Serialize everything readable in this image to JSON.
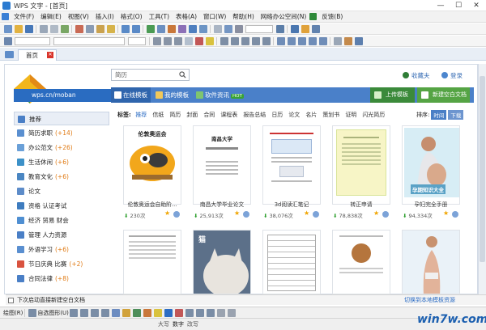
{
  "window": {
    "title": "WPS 文字 - [首页]",
    "minimize": "—",
    "maximize": "☐",
    "close": "✕"
  },
  "menu": [
    "文件(F)",
    "编辑(E)",
    "视图(V)",
    "插入(I)",
    "格式(O)",
    "工具(T)",
    "表格(A)",
    "窗口(W)",
    "帮助(H)",
    "网络办公空间(N)",
    "反馈(B)"
  ],
  "menu_extra": {
    "feedback_icon": "feedback-icon"
  },
  "tabs": [
    {
      "label": "首页",
      "close": "✕"
    }
  ],
  "site": {
    "logo_text": "wps.cn/moban",
    "search_placeholder": "简历",
    "favorite": "收藏夫",
    "login": "登录"
  },
  "nav": {
    "online": "在线模板",
    "mine": "我的模板",
    "software": "软件资讯",
    "hot": "HOT",
    "upload": "上传模板",
    "new_blank": "新建空白文档"
  },
  "sidebar": [
    {
      "label": "推荐",
      "count": "",
      "color": "#4a7fc6"
    },
    {
      "label": "简历求职",
      "count": "(+14)",
      "color": "#5a8fd0"
    },
    {
      "label": "办公范文",
      "count": "(+26)",
      "color": "#6aa0d8"
    },
    {
      "label": "生活休闲",
      "count": "(+6)",
      "color": "#3c91c8"
    },
    {
      "label": "教育文化",
      "count": "(+6)",
      "color": "#4a86c2"
    },
    {
      "label": "论文",
      "count": "",
      "color": "#5d8cc9"
    },
    {
      "label": "资格 认证考试",
      "count": "",
      "color": "#3e7cbf"
    },
    {
      "label": "经济 贸易 财会",
      "count": "",
      "color": "#4f8fd2"
    },
    {
      "label": "管理 人力资源",
      "count": "",
      "color": "#4a7fc6"
    },
    {
      "label": "外语学习",
      "count": "(+6)",
      "color": "#5a8fd0"
    },
    {
      "label": "节日庆典 比赛",
      "count": "(+2)",
      "color": "#d9533f"
    },
    {
      "label": "合同法律",
      "count": "(+8)",
      "color": "#4a7fc6"
    }
  ],
  "tags": {
    "label": "标签:",
    "items": [
      "推荐",
      "信纸",
      "简历",
      "封面",
      "合同",
      "课程表",
      "报告总结",
      "日历",
      "论文",
      "名片",
      "策划书",
      "证明",
      "闪光简历"
    ]
  },
  "sort": {
    "label": "排序:",
    "time": "时间",
    "downloads": "下载"
  },
  "cards": [
    {
      "title": "伦敦奥运会自助阶...",
      "downloads": "230",
      "unit": "次",
      "cover_title": "伦敦奥运会"
    },
    {
      "title": "南昌大学毕业论文",
      "downloads": "25,913",
      "unit": "次",
      "cover_title": "南昌大学"
    },
    {
      "title": "3d阅读汇笔记",
      "downloads": "38,076",
      "unit": "次",
      "cover_title": ""
    },
    {
      "title": "转正申请",
      "downloads": "78,838",
      "unit": "次",
      "cover_title": ""
    },
    {
      "title": "孕妇完全手册",
      "downloads": "94,334",
      "unit": "次",
      "cover_title": "孕期知识大全"
    }
  ],
  "cards_row2": [
    {
      "cover_title": ""
    },
    {
      "cover_title": "猫"
    },
    {
      "cover_title": ""
    },
    {
      "cover_title": ""
    },
    {
      "cover_title": ""
    }
  ],
  "footer": {
    "startup_checkbox": "下次启动直接新建空白文档",
    "switch_local": "切换到本地模板资源"
  },
  "drawbar": {
    "draw": "绘图(R)",
    "autoshape": "自选图形(U)"
  },
  "status": {
    "items": [
      "大写",
      "数字",
      "改写"
    ]
  },
  "watermark": "win7w.com"
}
